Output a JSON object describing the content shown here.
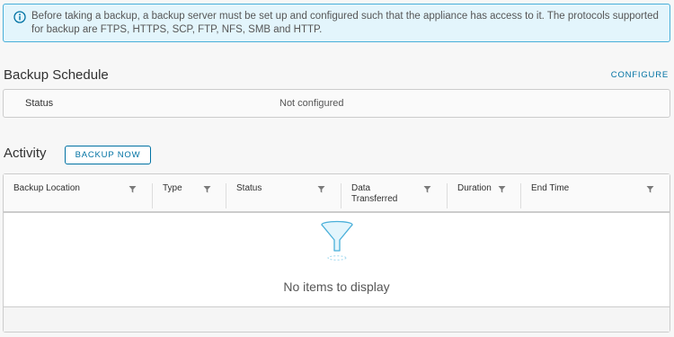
{
  "banner": {
    "icon": "info-icon",
    "text": "Before taking a backup, a backup server must be set up and configured such that the appliance has access to it. The protocols supported for backup are FTPS, HTTPS, SCP, FTP, NFS, SMB and HTTP."
  },
  "backup_schedule": {
    "title": "Backup Schedule",
    "configure_label": "CONFIGURE",
    "status_label": "Status",
    "status_value": "Not configured"
  },
  "activity": {
    "title": "Activity",
    "backup_now_label": "BACKUP NOW",
    "columns": [
      {
        "label": "Backup Location"
      },
      {
        "label": "Type"
      },
      {
        "label": "Status"
      },
      {
        "label": "Data\nTransferred"
      },
      {
        "label": "Duration"
      },
      {
        "label": "End Time"
      }
    ],
    "empty_text": "No items to display",
    "empty_icon": "funnel-icon"
  },
  "colors": {
    "accent": "#0072a3",
    "banner_bg": "#e3f5fc",
    "banner_border": "#49afd9"
  }
}
